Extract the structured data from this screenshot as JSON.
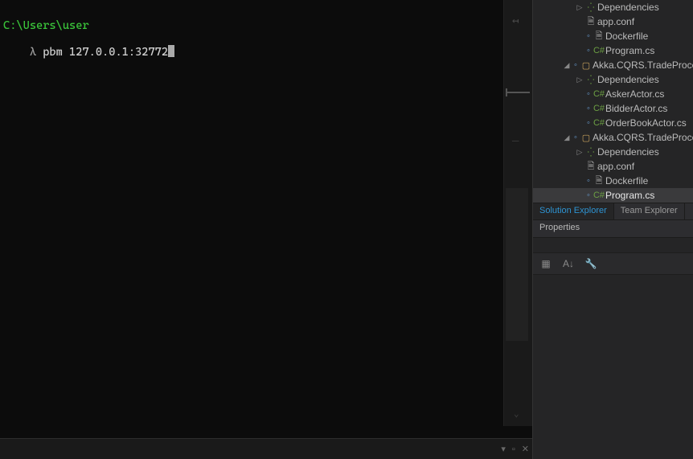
{
  "terminal": {
    "cwd": "C:\\Users\\user",
    "prompt_char": "λ",
    "command": "pbm 127.0.0.1:32772"
  },
  "solution_explorer": {
    "items": [
      {
        "indent": 3,
        "chev": "▷",
        "icon": "ref",
        "label": "Dependencies"
      },
      {
        "indent": 3,
        "chev": "",
        "icon": "doc",
        "label": "app.conf"
      },
      {
        "indent": 3,
        "chev": "",
        "icon": "doc",
        "label": "Dockerfile",
        "hash": true
      },
      {
        "indent": 3,
        "chev": "",
        "icon": "cs",
        "label": "Program.cs",
        "hash": true
      },
      {
        "indent": 2,
        "chev": "◢",
        "icon": "proj",
        "label": "Akka.CQRS.TradeProces",
        "hash": true
      },
      {
        "indent": 3,
        "chev": "▷",
        "icon": "ref",
        "label": "Dependencies"
      },
      {
        "indent": 3,
        "chev": "",
        "icon": "cs",
        "label": "AskerActor.cs",
        "hash": true
      },
      {
        "indent": 3,
        "chev": "",
        "icon": "cs",
        "label": "BidderActor.cs",
        "hash": true
      },
      {
        "indent": 3,
        "chev": "",
        "icon": "cs",
        "label": "OrderBookActor.cs",
        "hash": true
      },
      {
        "indent": 2,
        "chev": "◢",
        "icon": "proj",
        "label": "Akka.CQRS.TradeProces",
        "hash": true
      },
      {
        "indent": 3,
        "chev": "▷",
        "icon": "ref",
        "label": "Dependencies"
      },
      {
        "indent": 3,
        "chev": "",
        "icon": "doc",
        "label": "app.conf"
      },
      {
        "indent": 3,
        "chev": "",
        "icon": "doc",
        "label": "Dockerfile",
        "hash": true
      },
      {
        "indent": 3,
        "chev": "",
        "icon": "cs",
        "label": "Program.cs",
        "hash": true,
        "selected": true
      }
    ]
  },
  "tabs": {
    "items": [
      {
        "label": "Solution Explorer",
        "active": true
      },
      {
        "label": "Team Explorer",
        "active": false
      }
    ]
  },
  "properties": {
    "title": "Properties",
    "toolbar": [
      "categorized-icon",
      "alphabetical-icon",
      "wrench-icon"
    ]
  },
  "output_panel": {
    "controls": [
      "▾",
      "▫",
      "✕"
    ]
  }
}
